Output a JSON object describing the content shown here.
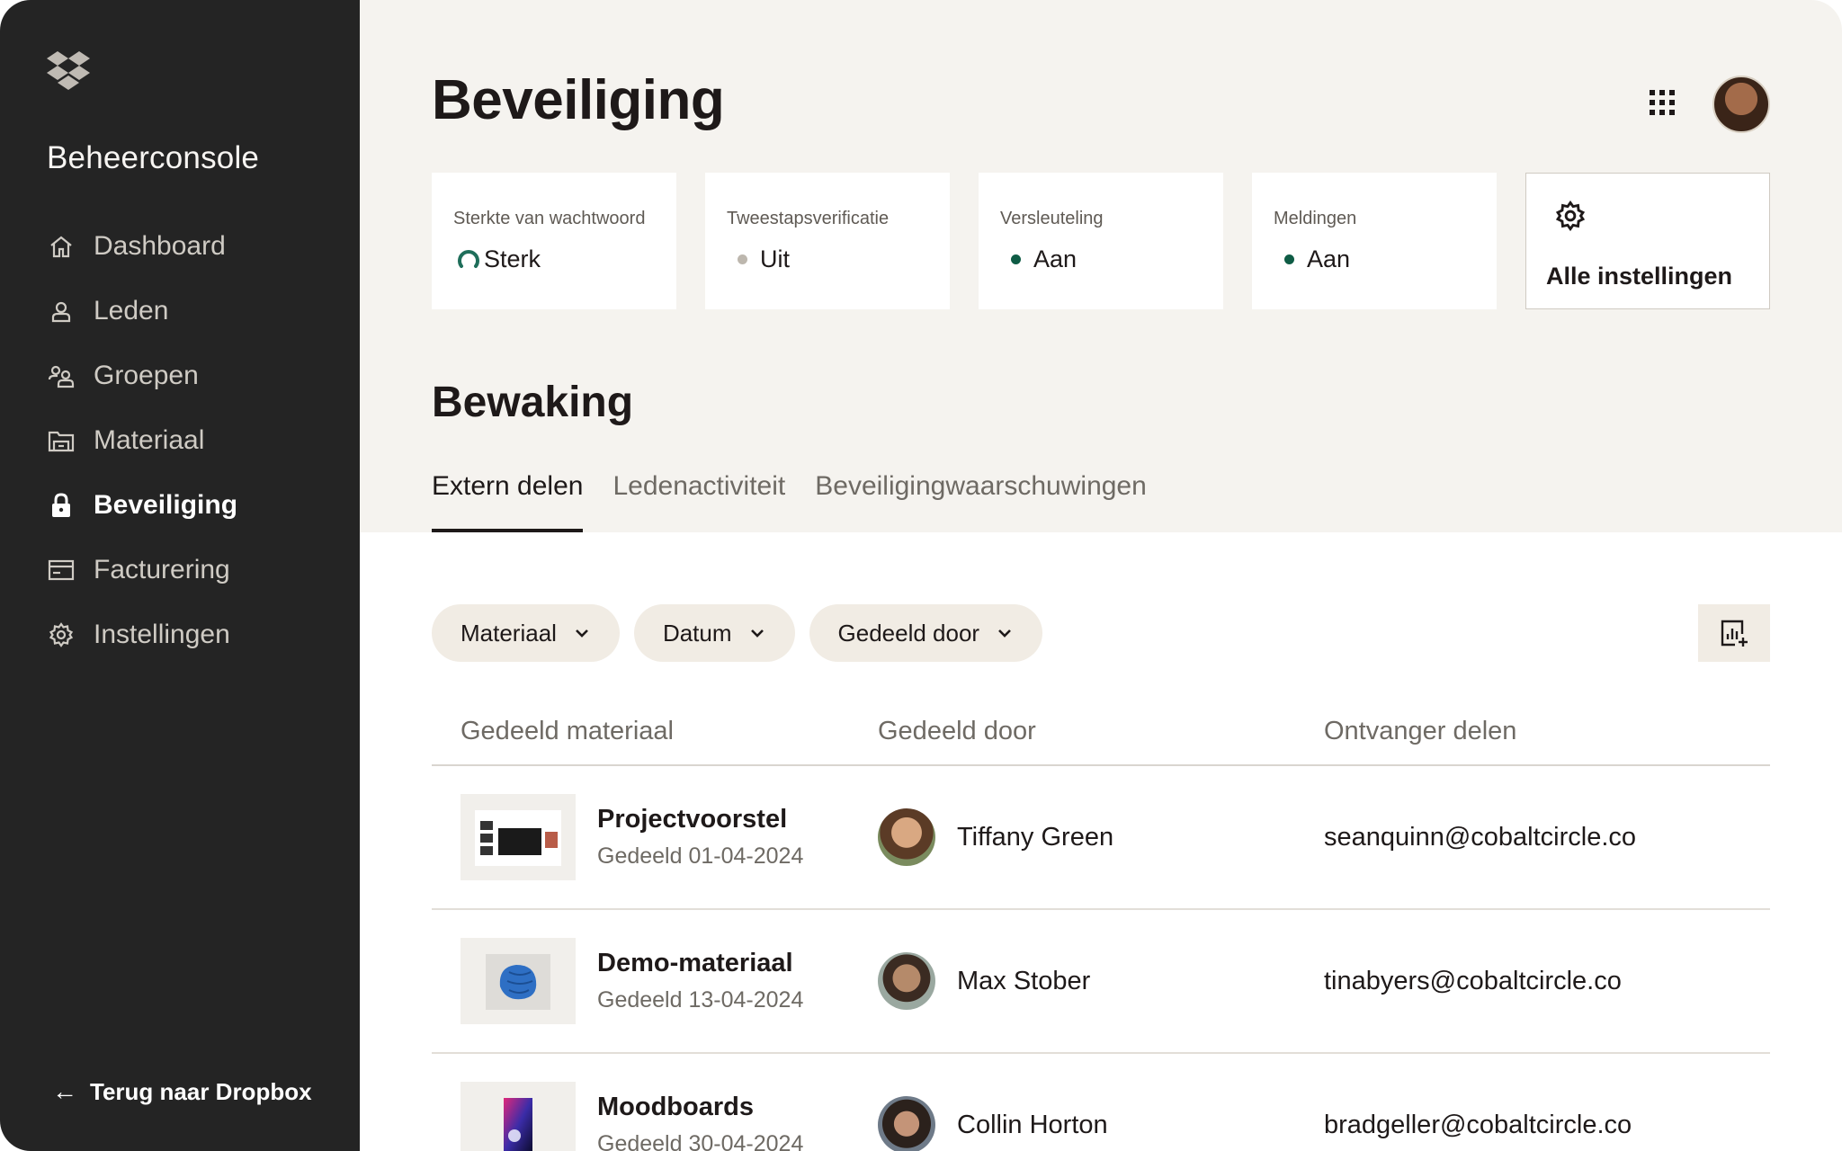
{
  "sidebar": {
    "title": "Beheerconsole",
    "items": [
      {
        "label": "Dashboard",
        "icon": "home-icon"
      },
      {
        "label": "Leden",
        "icon": "user-icon"
      },
      {
        "label": "Groepen",
        "icon": "group-icon"
      },
      {
        "label": "Materiaal",
        "icon": "folder-icon"
      },
      {
        "label": "Beveiliging",
        "icon": "lock-icon",
        "active": true
      },
      {
        "label": "Facturering",
        "icon": "billing-icon"
      },
      {
        "label": "Instellingen",
        "icon": "gear-icon"
      }
    ],
    "back_label": "Terug naar Dropbox"
  },
  "header": {
    "title": "Beveiliging"
  },
  "status_cards": [
    {
      "label": "Sterkte van wachtwoord",
      "value": "Sterk",
      "indicator": "strength-ring",
      "color": "#1f6e5a"
    },
    {
      "label": "Tweestapsverificatie",
      "value": "Uit",
      "indicator": "dot",
      "color": "#bdb7ae"
    },
    {
      "label": "Versleuteling",
      "value": "Aan",
      "indicator": "dot",
      "color": "#0f5c45"
    },
    {
      "label": "Meldingen",
      "value": "Aan",
      "indicator": "dot",
      "color": "#0f5c45"
    }
  ],
  "settings_card": {
    "label": "Alle instellingen"
  },
  "monitoring": {
    "title": "Bewaking",
    "tabs": [
      "Extern delen",
      "Ledenactiviteit",
      "Beveiligingwaarschuwingen"
    ],
    "active_tab": 0
  },
  "filters": [
    "Materiaal",
    "Datum",
    "Gedeeld door"
  ],
  "table": {
    "headers": [
      "Gedeeld materiaal",
      "Gedeeld door",
      "Ontvanger delen"
    ],
    "rows": [
      {
        "name": "Projectvoorstel",
        "date": "Gedeeld 01-04-2024",
        "by": "Tiffany Green",
        "recipient": "seanquinn@cobaltcircle.co"
      },
      {
        "name": "Demo-materiaal",
        "date": "Gedeeld 13-04-2024",
        "by": "Max Stober",
        "recipient": "tinabyers@cobaltcircle.co"
      },
      {
        "name": "Moodboards",
        "date": "Gedeeld 30-04-2024",
        "by": "Collin Horton",
        "recipient": "bradgeller@cobaltcircle.co"
      }
    ]
  },
  "colors": {
    "sidebar_bg": "#242424",
    "top_bg": "#f5f3ef",
    "chip_bg": "#f1ece4",
    "text": "#1e1919"
  }
}
